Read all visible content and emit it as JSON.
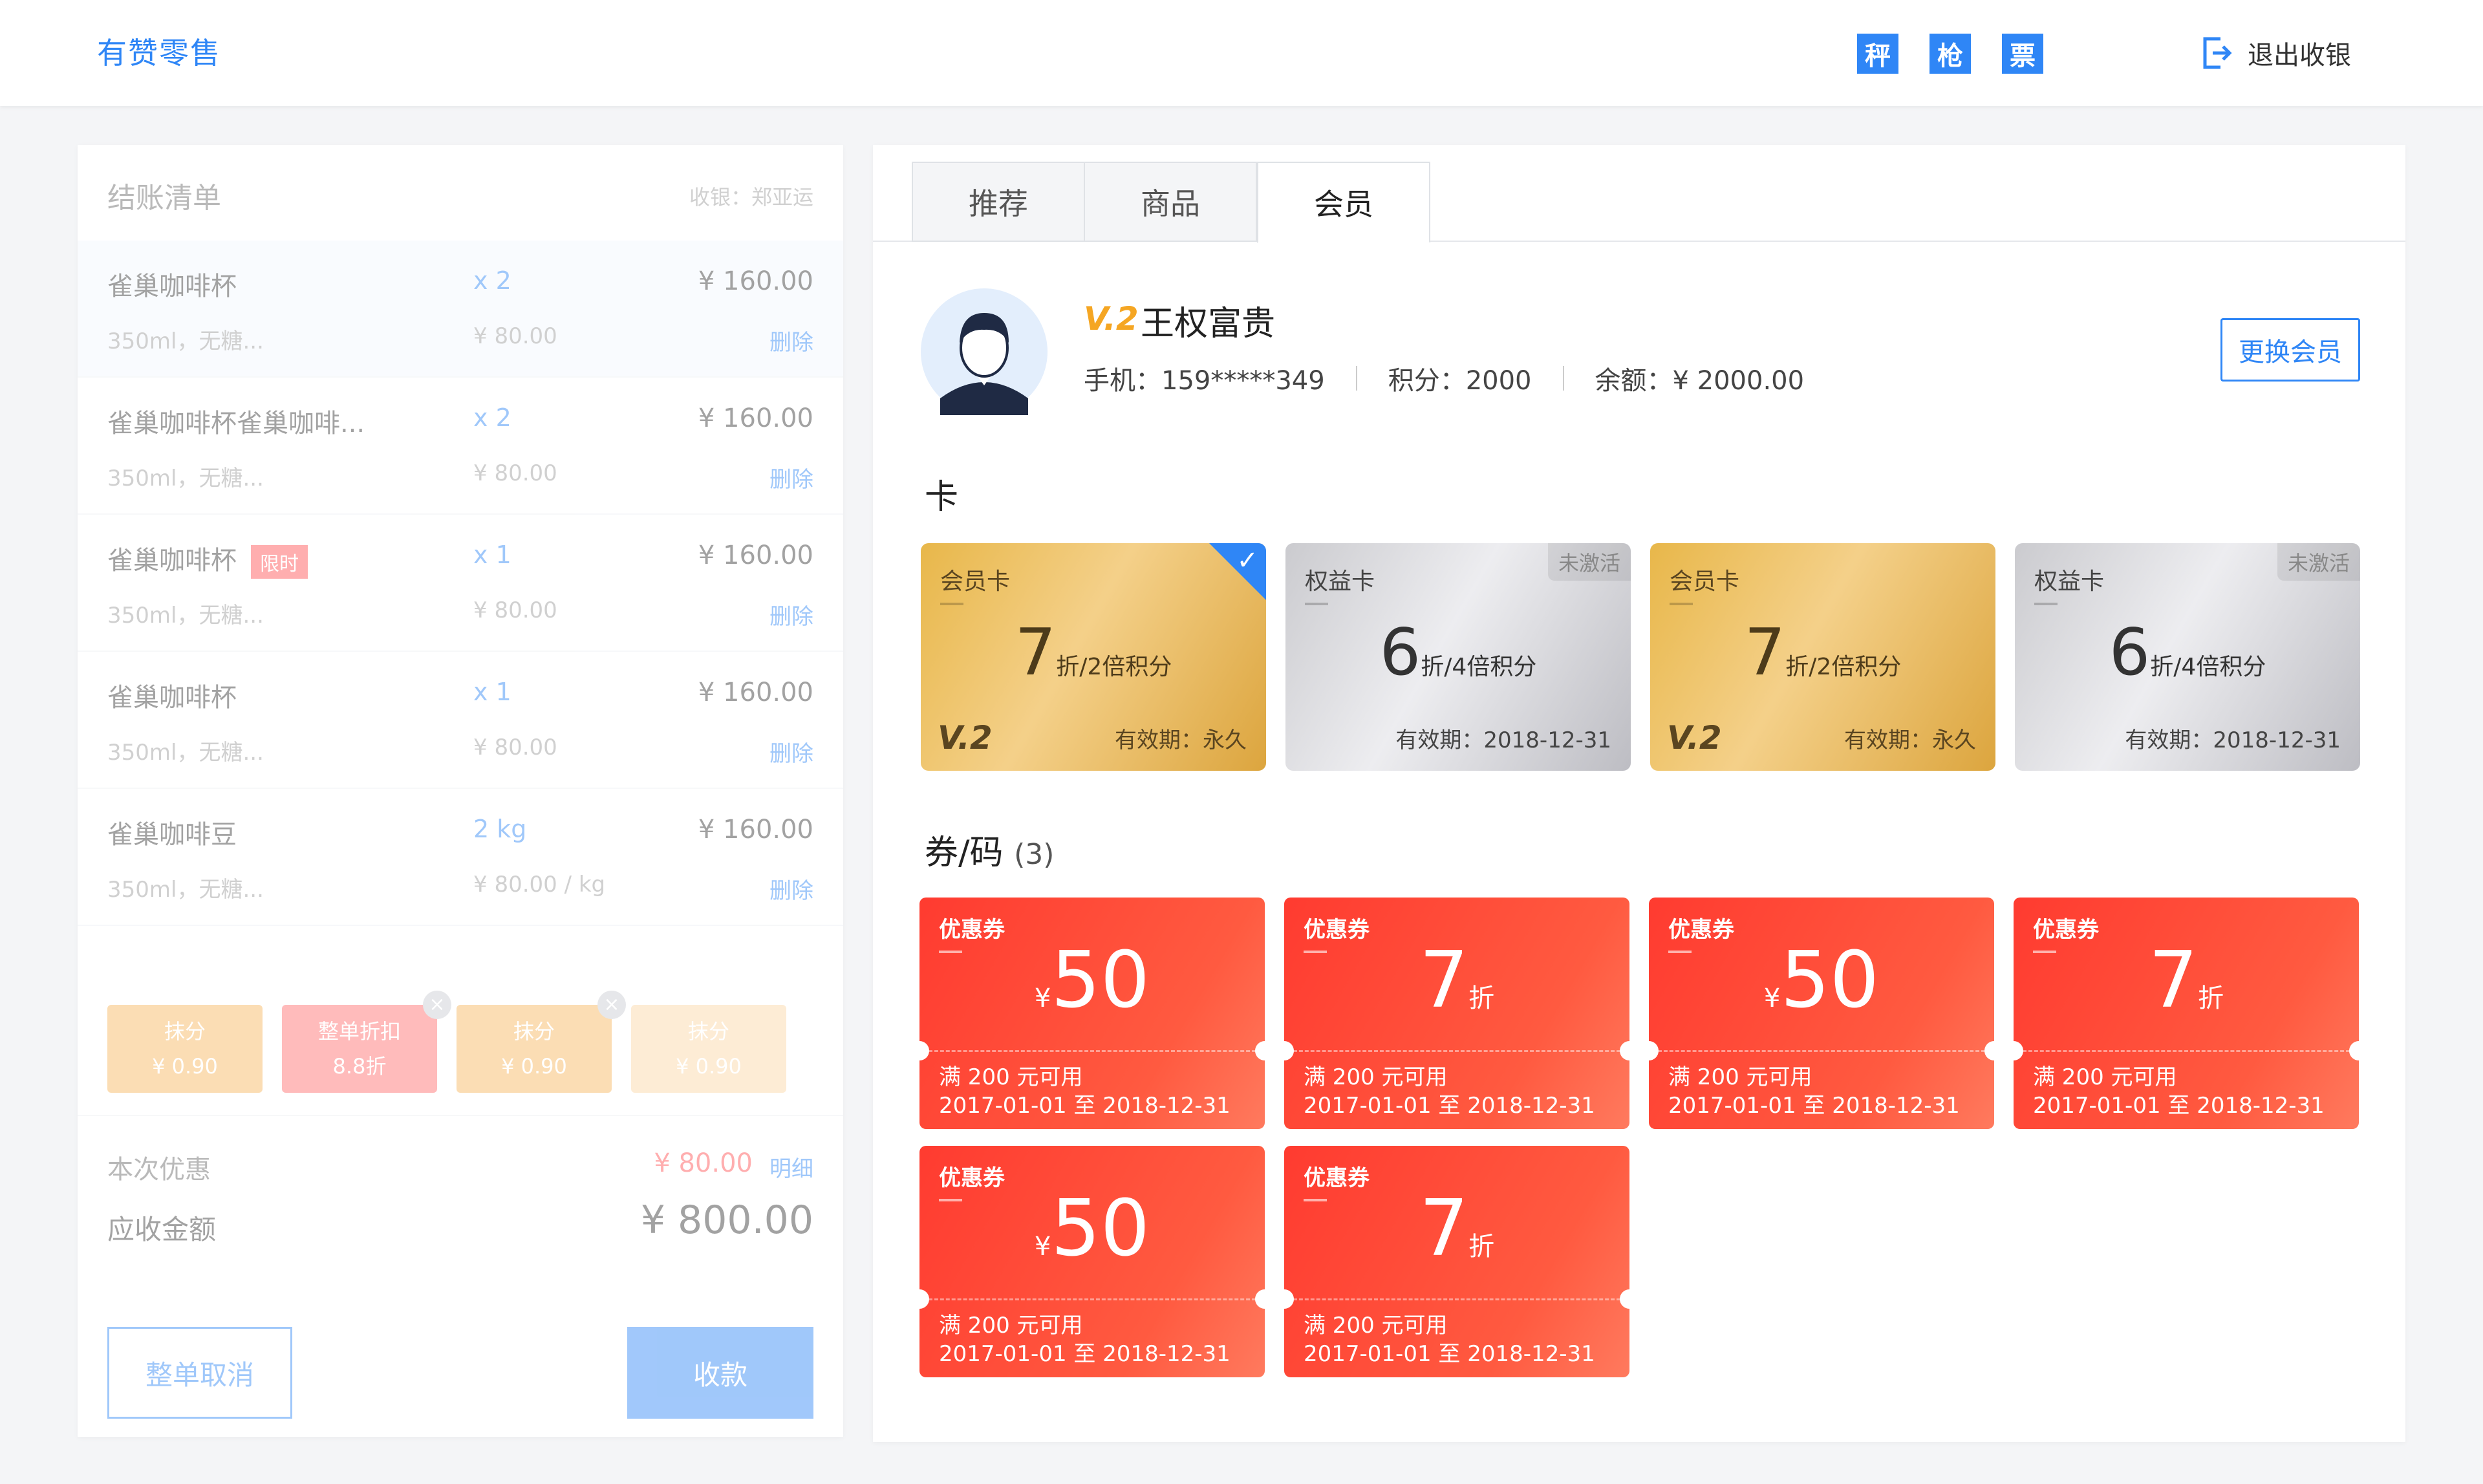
{
  "header": {
    "brand": "有赞零售",
    "quick_buttons": [
      "秤",
      "枪",
      "票"
    ],
    "exit_label": "退出收银"
  },
  "checkout": {
    "title": "结账清单",
    "cashier": "收银：郑亚运",
    "items": [
      {
        "name": "雀巢咖啡杯",
        "qty": "x 2",
        "price": "¥ 160.00",
        "spec": "350ml，无糖...",
        "unit": "¥ 80.00",
        "delete": "删除",
        "tag": ""
      },
      {
        "name": "雀巢咖啡杯雀巢咖啡...",
        "qty": "x 2",
        "price": "¥ 160.00",
        "spec": "350ml，无糖...",
        "unit": "¥ 80.00",
        "delete": "删除",
        "tag": ""
      },
      {
        "name": "雀巢咖啡杯",
        "qty": "x 1",
        "price": "¥ 160.00",
        "spec": "350ml，无糖...",
        "unit": "¥ 80.00",
        "delete": "删除",
        "tag": "限时"
      },
      {
        "name": "雀巢咖啡杯",
        "qty": "x 1",
        "price": "¥ 160.00",
        "spec": "350ml，无糖...",
        "unit": "¥ 80.00",
        "delete": "删除",
        "tag": ""
      },
      {
        "name": "雀巢咖啡豆",
        "qty": "2 kg",
        "price": "¥ 160.00",
        "spec": "350ml，无糖...",
        "unit": "¥ 80.00 / kg",
        "delete": "删除",
        "tag": ""
      }
    ],
    "chips": [
      {
        "title": "抹分",
        "value": "¥ 0.90",
        "color": "#f7b55a"
      },
      {
        "title": "整单折扣",
        "value": "8.8折",
        "color": "#ff6b6b"
      },
      {
        "title": "抹分",
        "value": "¥ 0.90",
        "color": "#f7b55a"
      },
      {
        "title": "抹分",
        "value": "¥ 0.90",
        "color": "#fbd6a3"
      }
    ],
    "discount_label": "本次优惠",
    "discount_value": "¥ 80.00",
    "detail_link": "明细",
    "due_label": "应收金额",
    "due_value": "¥ 800.00",
    "cancel_label": "整单取消",
    "pay_label": "收款"
  },
  "tabs": [
    "推荐",
    "商品",
    "会员"
  ],
  "active_tab": "会员",
  "member": {
    "level": "V.2",
    "name": "王权富贵",
    "phone": "手机：159*****349",
    "points": "积分：2000",
    "balance": "余额：¥ 2000.00",
    "change_button": "更换会员"
  },
  "cards_title": "卡",
  "cards": [
    {
      "title": "会员卡",
      "num": "7",
      "unit": "折/2倍积分",
      "expiry": "有效期：永久",
      "level": "V.2",
      "style": "gold",
      "status": "",
      "selected": true
    },
    {
      "title": "权益卡",
      "num": "6",
      "unit": "折/4倍积分",
      "expiry": "有效期：2018-12-31",
      "level": "",
      "style": "silver",
      "status": "未激活",
      "selected": false
    },
    {
      "title": "会员卡",
      "num": "7",
      "unit": "折/2倍积分",
      "expiry": "有效期：永久",
      "level": "V.2",
      "style": "gold",
      "status": "",
      "selected": false
    },
    {
      "title": "权益卡",
      "num": "6",
      "unit": "折/4倍积分",
      "expiry": "有效期：2018-12-31",
      "level": "",
      "style": "silver",
      "status": "未激活",
      "selected": false
    }
  ],
  "coupons_title": "券/码",
  "coupons_count": "(3)",
  "coupons": [
    {
      "title": "优惠券",
      "prefix": "¥",
      "num": "50",
      "suffix": "",
      "condition": "满 200 元可用",
      "range": "2017-01-01 至 2018-12-31"
    },
    {
      "title": "优惠券",
      "prefix": "",
      "num": "7",
      "suffix": "折",
      "condition": "满 200 元可用",
      "range": "2017-01-01 至 2018-12-31"
    },
    {
      "title": "优惠券",
      "prefix": "¥",
      "num": "50",
      "suffix": "",
      "condition": "满 200 元可用",
      "range": "2017-01-01 至 2018-12-31"
    },
    {
      "title": "优惠券",
      "prefix": "",
      "num": "7",
      "suffix": "折",
      "condition": "满 200 元可用",
      "range": "2017-01-01 至 2018-12-31"
    },
    {
      "title": "优惠券",
      "prefix": "¥",
      "num": "50",
      "suffix": "",
      "condition": "满 200 元可用",
      "range": "2017-01-01 至 2018-12-31"
    },
    {
      "title": "优惠券",
      "prefix": "",
      "num": "7",
      "suffix": "折",
      "condition": "满 200 元可用",
      "range": "2017-01-01 至 2018-12-31"
    }
  ]
}
